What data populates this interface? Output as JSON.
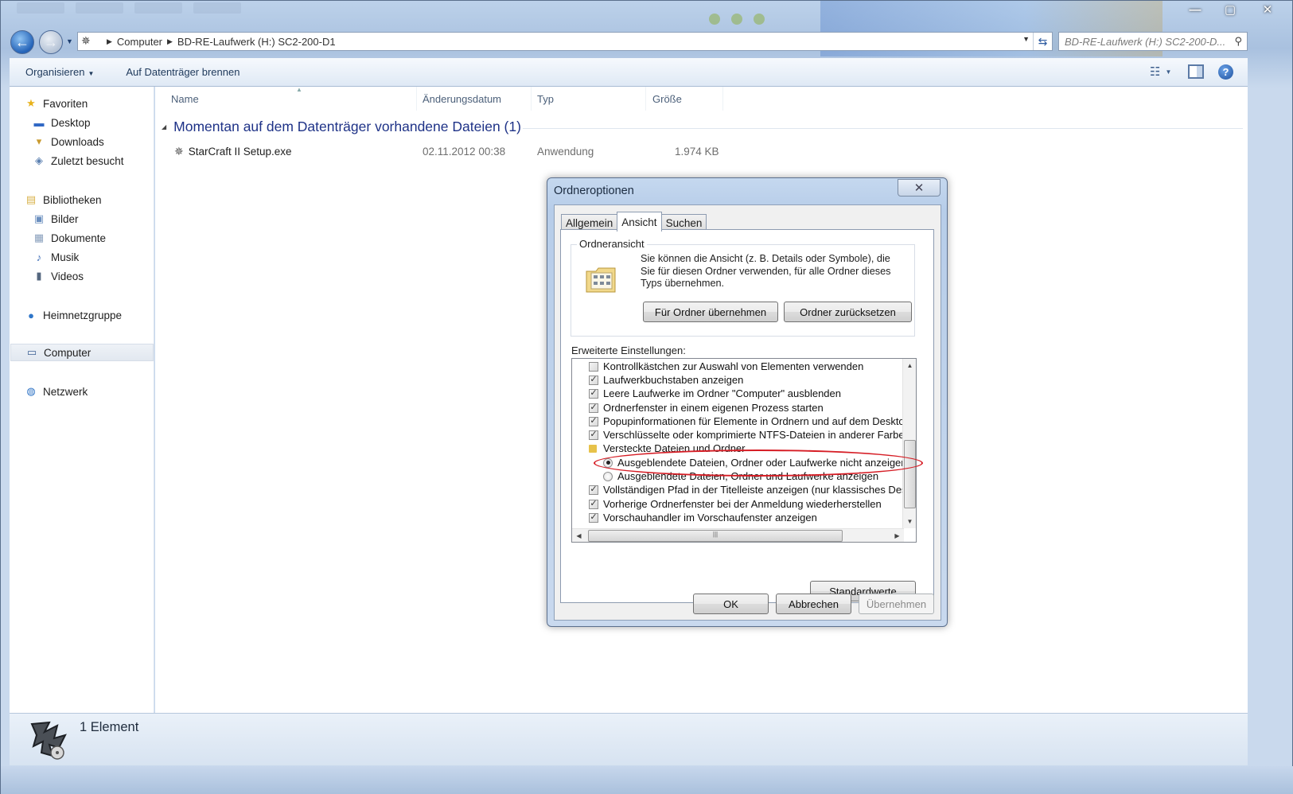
{
  "explorer": {
    "address": {
      "crumb1": "Computer",
      "crumb2": "BD-RE-Laufwerk (H:) SC2-200-D1"
    },
    "search_placeholder": "BD-RE-Laufwerk (H:) SC2-200-D...",
    "toolbar": {
      "organize": "Organisieren",
      "burn": "Auf Datenträger brennen"
    },
    "nav": {
      "favorites": "Favoriten",
      "desktop": "Desktop",
      "downloads": "Downloads",
      "recent": "Zuletzt besucht",
      "libraries": "Bibliotheken",
      "pictures": "Bilder",
      "documents": "Dokumente",
      "music": "Musik",
      "videos": "Videos",
      "homegroup": "Heimnetzgruppe",
      "computer": "Computer",
      "network": "Netzwerk"
    },
    "columns": {
      "name": "Name",
      "date": "Änderungsdatum",
      "type": "Typ",
      "size": "Größe"
    },
    "group_header": "Momentan auf dem Datenträger vorhandene Dateien (1)",
    "files": [
      {
        "name": "StarCraft II Setup.exe",
        "date": "02.11.2012 00:38",
        "type": "Anwendung",
        "size": "1.974 KB"
      }
    ],
    "status": "1 Element"
  },
  "dialog": {
    "title": "Ordneroptionen",
    "tabs": [
      "Allgemein",
      "Ansicht",
      "Suchen"
    ],
    "active_tab": "Ansicht",
    "folder_view": {
      "legend": "Ordneransicht",
      "description": "Sie können die Ansicht (z. B. Details oder Symbole), die Sie für diesen Ordner verwenden, für alle Ordner dieses Typs übernehmen.",
      "apply_button": "Für Ordner übernehmen",
      "reset_button": "Ordner zurücksetzen"
    },
    "advanced_label": "Erweiterte Einstellungen:",
    "settings": [
      {
        "type": "checkbox",
        "checked": false,
        "label": "Kontrollkästchen zur Auswahl von Elementen verwenden"
      },
      {
        "type": "checkbox",
        "checked": true,
        "label": "Laufwerkbuchstaben anzeigen"
      },
      {
        "type": "checkbox",
        "checked": true,
        "label": "Leere Laufwerke im Ordner \"Computer\" ausblenden"
      },
      {
        "type": "checkbox",
        "checked": true,
        "label": "Ordnerfenster in einem eigenen Prozess starten"
      },
      {
        "type": "checkbox",
        "checked": true,
        "label": "Popupinformationen für Elemente in Ordnern und auf dem Desktop"
      },
      {
        "type": "checkbox",
        "checked": true,
        "label": "Verschlüsselte oder komprimierte NTFS-Dateien in anderer Farbe"
      },
      {
        "type": "folder",
        "label": "Versteckte Dateien und Ordner"
      },
      {
        "type": "radio",
        "checked": true,
        "label": "Ausgeblendete Dateien, Ordner oder Laufwerke nicht anzeigen"
      },
      {
        "type": "radio",
        "checked": false,
        "label": "Ausgeblendete Dateien, Ordner und Laufwerke anzeigen"
      },
      {
        "type": "checkbox",
        "checked": true,
        "label": "Vollständigen Pfad in der Titelleiste anzeigen (nur klassisches Design)"
      },
      {
        "type": "checkbox",
        "checked": true,
        "label": "Vorherige Ordnerfenster bei der Anmeldung wiederherstellen"
      },
      {
        "type": "checkbox",
        "checked": true,
        "label": "Vorschauhandler im Vorschaufenster anzeigen"
      }
    ],
    "defaults_button": "Standardwerte",
    "ok": "OK",
    "cancel": "Abbrechen",
    "apply": "Übernehmen"
  },
  "colors": {
    "highlight": "#d61d25",
    "group_header": "#1e3287"
  }
}
